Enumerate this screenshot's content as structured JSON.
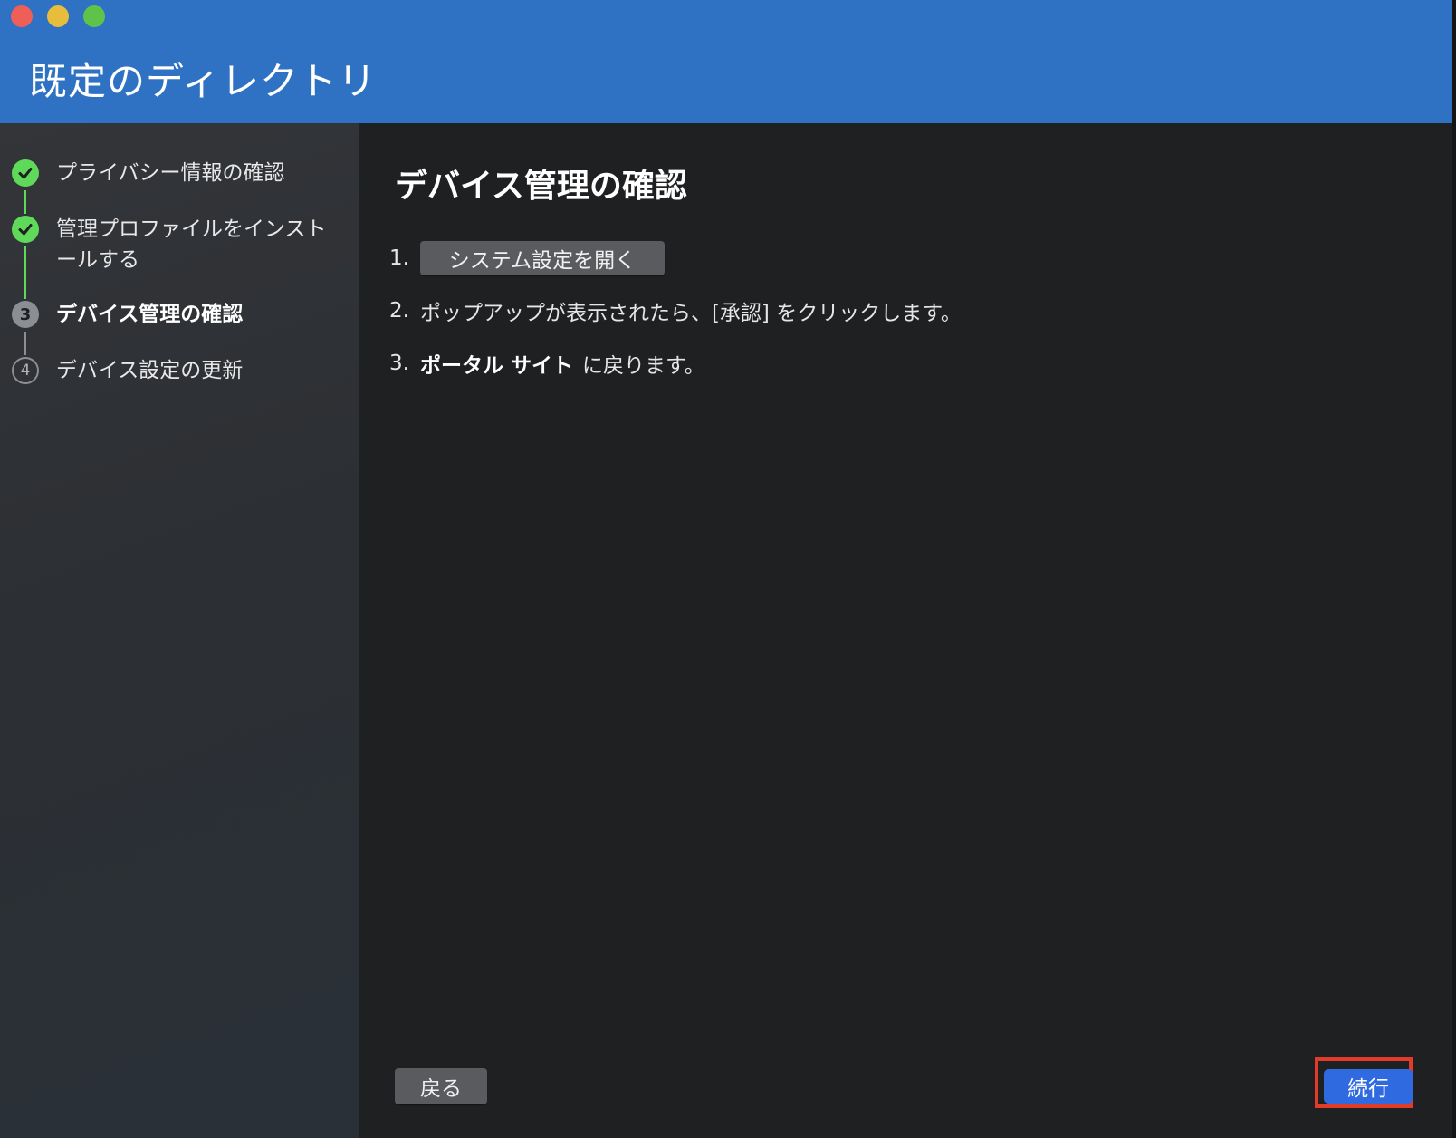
{
  "window": {
    "title": "既定のディレクトリ",
    "traffic_lights": [
      {
        "name": "close",
        "color": "#ee5f57"
      },
      {
        "name": "minimize",
        "color": "#e9bd3c"
      },
      {
        "name": "zoom",
        "color": "#5fc34a"
      }
    ]
  },
  "sidebar": {
    "steps": [
      {
        "label": "プライバシー情報の確認",
        "status": "done",
        "icon": "checkmark-icon"
      },
      {
        "label": "管理プロファイルをインストールする",
        "status": "done",
        "icon": "checkmark-icon"
      },
      {
        "label": "デバイス管理の確認",
        "status": "current",
        "number": "3"
      },
      {
        "label": "デバイス設定の更新",
        "status": "pending",
        "number": "4"
      }
    ]
  },
  "main": {
    "title": "デバイス管理の確認",
    "steps": [
      {
        "number": "1.",
        "button_label": "システム設定を開く"
      },
      {
        "number": "2.",
        "text": "ポップアップが表示されたら、[承認] をクリックします。"
      },
      {
        "number": "3.",
        "bold": "ポータル サイト",
        "text": "に戻ります。"
      }
    ]
  },
  "footer": {
    "back_label": "戻る",
    "continue_label": "続行"
  },
  "colors": {
    "header": "#2f72c4",
    "accent_green": "#5fd95a",
    "primary_button": "#2f6ae0",
    "highlight": "#e23b2a"
  }
}
